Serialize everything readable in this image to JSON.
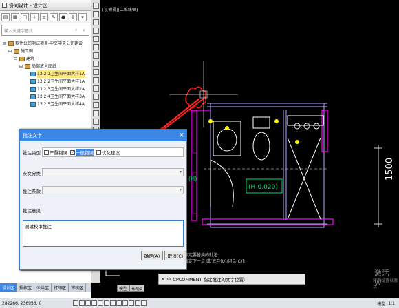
{
  "left_panel": {
    "title": "协同设计 - 设计区",
    "search_placeholder": "输入关键字查找",
    "tree": [
      {
        "label": "软件公司测试项目-中交中央公司建设",
        "level": 0,
        "kind": "folder"
      },
      {
        "label": "施工图",
        "level": 1,
        "kind": "folder"
      },
      {
        "label": "建筑",
        "level": 2,
        "kind": "folder"
      },
      {
        "label": "局部放大图纸",
        "level": 3,
        "kind": "folder"
      },
      {
        "label": "13.2.1卫生间平面大样1A",
        "level": 4,
        "kind": "leaf",
        "selected": true
      },
      {
        "label": "13.2.2卫生间平面大样1A",
        "level": 4,
        "kind": "leaf"
      },
      {
        "label": "13.2.3卫生间平面大样2A",
        "level": 4,
        "kind": "leaf"
      },
      {
        "label": "13.2.4卫生间平面大样3A",
        "level": 4,
        "kind": "leaf"
      },
      {
        "label": "13.2.5卫生间平面大样4A",
        "level": 4,
        "kind": "leaf"
      }
    ]
  },
  "bottom_tabs": [
    "设计区",
    "授权区",
    "公共区",
    "打印区",
    "审核区"
  ],
  "canvas": {
    "viewport_label": "[-][俯视][二维线框]",
    "dimension_label": "1500",
    "elevation_label": "(H-0.020)",
    "partial_label": "(H)"
  },
  "dialog": {
    "title": "批注文字",
    "type_label": "批注类型",
    "type_options": [
      {
        "label": "严重错误",
        "checked": false
      },
      {
        "label": "一般错误",
        "checked": true
      },
      {
        "label": "优化建议",
        "checked": false
      }
    ],
    "clause_category_label": "条文分类",
    "clause_label": "批注条款",
    "opinion_label": "批注意见",
    "opinion_text": "测试校审批注",
    "ok_label": "确定(A)",
    "cancel_label": "取消(C)"
  },
  "command": {
    "history_1": "指定要替换的批注:",
    "history_2": "指定下一点 或[放弃(U)/闭合(C)]:",
    "prompt": "CPCOMMENT 指定批注的文字位置:"
  },
  "layout_tabs": [
    "模型",
    "布局1"
  ],
  "status": {
    "coords": "282266, 236956, 0",
    "model_label": "模型",
    "scale": "1:1"
  },
  "watermark": "激活 W",
  "watermark2": "转到设置以激活"
}
